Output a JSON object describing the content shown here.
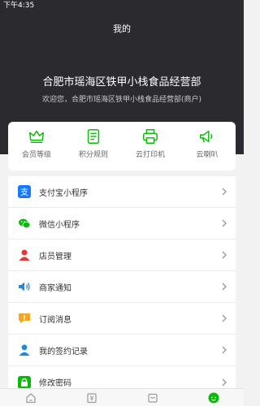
{
  "status_bar": {
    "time": "下午4:35"
  },
  "header": {
    "title": "我的",
    "store_name": "合肥市瑶海区铁甲小栈食品经营部",
    "welcome": "欢迎您，合肥市瑶海区铁甲小栈食品经营部(商户)"
  },
  "quick_actions": [
    {
      "label": "会员等级",
      "icon": "crown-icon"
    },
    {
      "label": "积分规则",
      "icon": "document-icon"
    },
    {
      "label": "云打印机",
      "icon": "printer-icon"
    },
    {
      "label": "云喇叭",
      "icon": "megaphone-icon"
    }
  ],
  "menu": [
    {
      "label": "支付宝小程序",
      "icon": "alipay-icon",
      "color": "#1677ff"
    },
    {
      "label": "微信小程序",
      "icon": "wechat-icon",
      "color": "#09bb07"
    },
    {
      "label": "店员管理",
      "icon": "staff-icon",
      "color": "#e53935"
    },
    {
      "label": "商家通知",
      "icon": "speaker-icon",
      "color": "#1e88e5"
    },
    {
      "label": "订阅消息",
      "icon": "message-icon",
      "color": "#f5a623"
    },
    {
      "label": "我的签约记录",
      "icon": "user-record-icon",
      "color": "#1e88e5"
    },
    {
      "label": "修改密码",
      "icon": "lock-icon",
      "color": "#09bb07"
    }
  ],
  "tabbar": [
    {
      "icon": "home-icon"
    },
    {
      "icon": "wallet-icon"
    },
    {
      "icon": "inbox-icon"
    },
    {
      "icon": "profile-icon",
      "active": true
    }
  ],
  "colors": {
    "header_bg": "#2b2b2f",
    "accent": "#09bb07",
    "page_bg": "#f2f2f2"
  }
}
